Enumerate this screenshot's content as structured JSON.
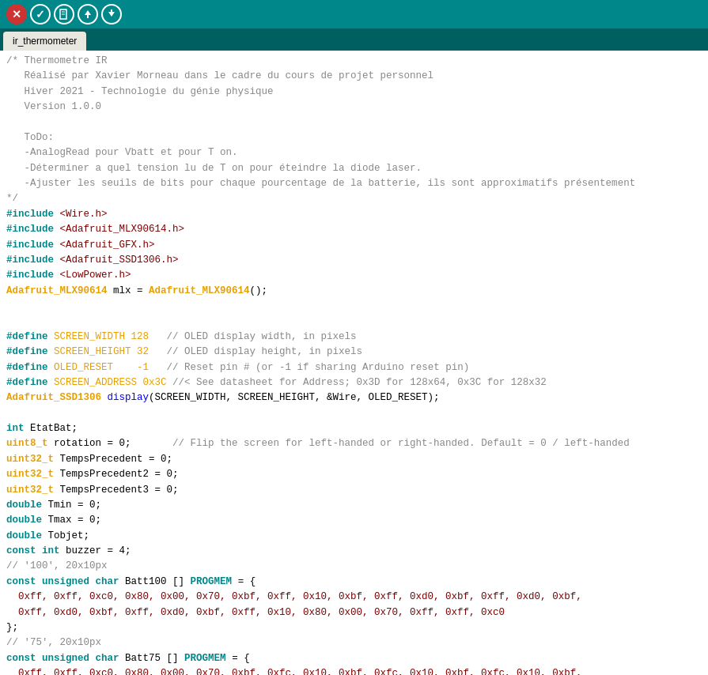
{
  "toolbar": {
    "background_color": "#00878a",
    "buttons": [
      {
        "label": "✕",
        "type": "close",
        "name": "close-button"
      },
      {
        "label": "✓",
        "type": "ok",
        "name": "ok-button"
      },
      {
        "label": "⎘",
        "type": "doc",
        "name": "new-file-button"
      },
      {
        "label": "↑",
        "type": "new",
        "name": "upload-button"
      },
      {
        "label": "↓",
        "type": "down",
        "name": "download-button"
      }
    ]
  },
  "tab": {
    "label": "ir_thermometer"
  },
  "code": {
    "content": "Arduino IDE code for IR thermometer"
  }
}
